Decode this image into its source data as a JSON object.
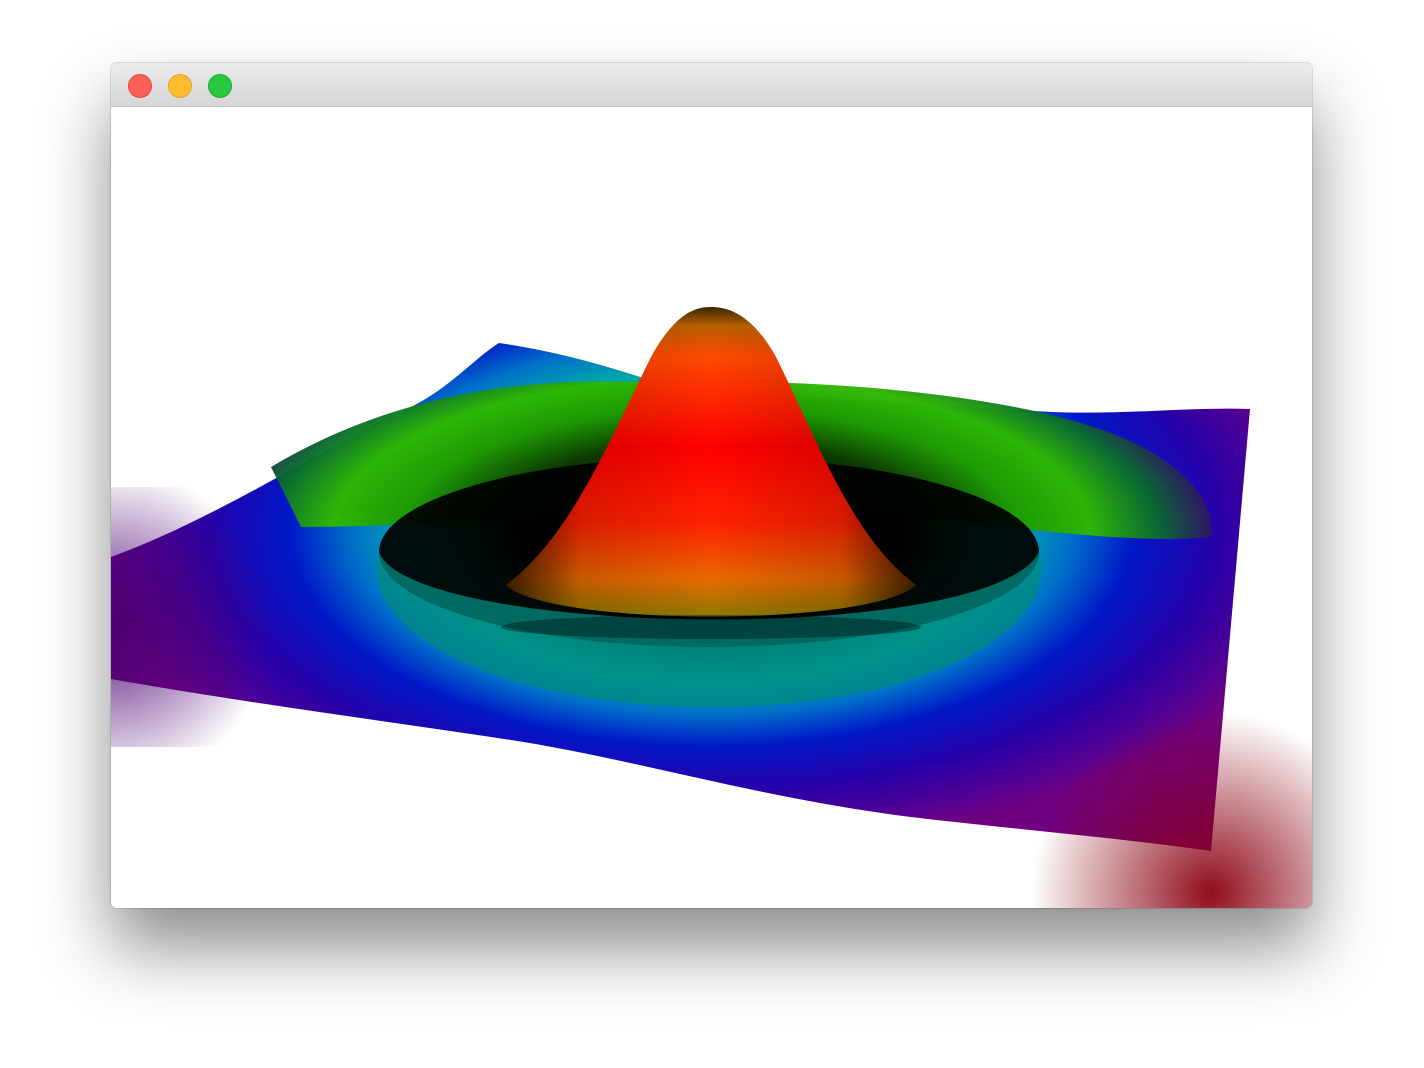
{
  "window": {
    "title": ""
  },
  "traffic_lights": {
    "close": {
      "color": "#ff5f57"
    },
    "minimize": {
      "color": "#febc2e"
    },
    "zoom": {
      "color": "#28c840"
    }
  },
  "surface_plot": {
    "shape": "radial damped ripple (sombrero-like) surface",
    "colormap": "rainbow",
    "colors": {
      "peak": "#ff0000",
      "shoulder": "#ff7a00",
      "ring_green": "#22b400",
      "ring_teal": "#00a8a8",
      "ring_blue": "#0018c8",
      "edge_purple": "#5a0090",
      "corner_red": "#8a0010"
    }
  }
}
